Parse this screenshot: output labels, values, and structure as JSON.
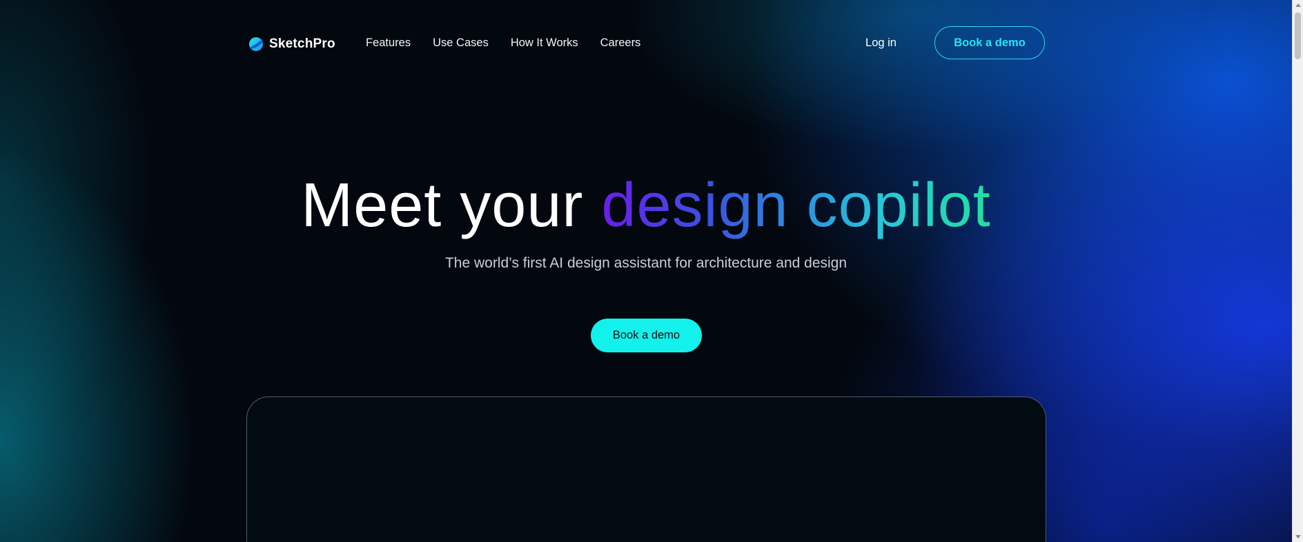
{
  "header": {
    "brand": "SketchPro",
    "nav": [
      {
        "label": "Features"
      },
      {
        "label": "Use Cases"
      },
      {
        "label": "How It Works"
      },
      {
        "label": "Careers"
      }
    ],
    "login_label": "Log in",
    "cta_label": "Book a demo"
  },
  "hero": {
    "title_plain": "Meet your ",
    "title_highlight": "design copilot",
    "subtitle": "The world’s first AI design assistant for architecture and design",
    "cta_label": "Book a demo"
  },
  "colors": {
    "accent": "#12f1ec",
    "background": "#03080f",
    "gradient_start": "#6a1ee8",
    "gradient_end": "#22e0a0"
  },
  "icons": {
    "logo": "sketchpro-logo-icon"
  }
}
